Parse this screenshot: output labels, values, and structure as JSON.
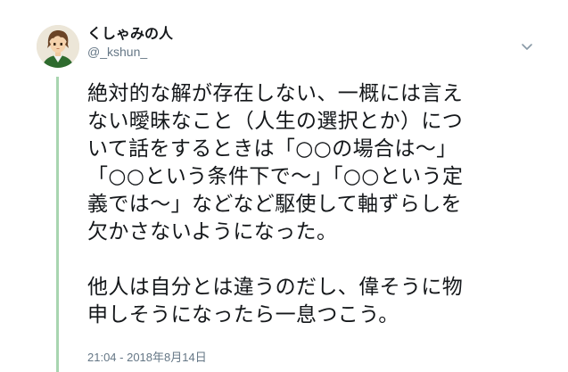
{
  "author": {
    "display_name": "くしゃみの人",
    "handle": "@_kshun_",
    "avatar_icon": "anime-character-avatar-icon"
  },
  "menu": {
    "icon": "chevron-down-icon"
  },
  "tweet": {
    "lines_p1": [
      "絶対的な解が存在しない、一概には言え",
      "ない曖昧なこと（人生の選択とか）につ",
      "いて話をするときは「○○の場合は〜」",
      "「○○という条件下で〜」「○○という定",
      "義では〜」などなど駆使して軸ずらしを",
      "欠かさないようになった。"
    ],
    "lines_p2": [
      "他人は自分とは違うのだし、偉そうに物",
      "申しそうになったら一息つこう。"
    ],
    "timestamp": "21:04 - 2018年8月14日"
  },
  "colors": {
    "thread_line": "#a8d5b0",
    "text": "#14171a",
    "secondary": "#657786"
  }
}
